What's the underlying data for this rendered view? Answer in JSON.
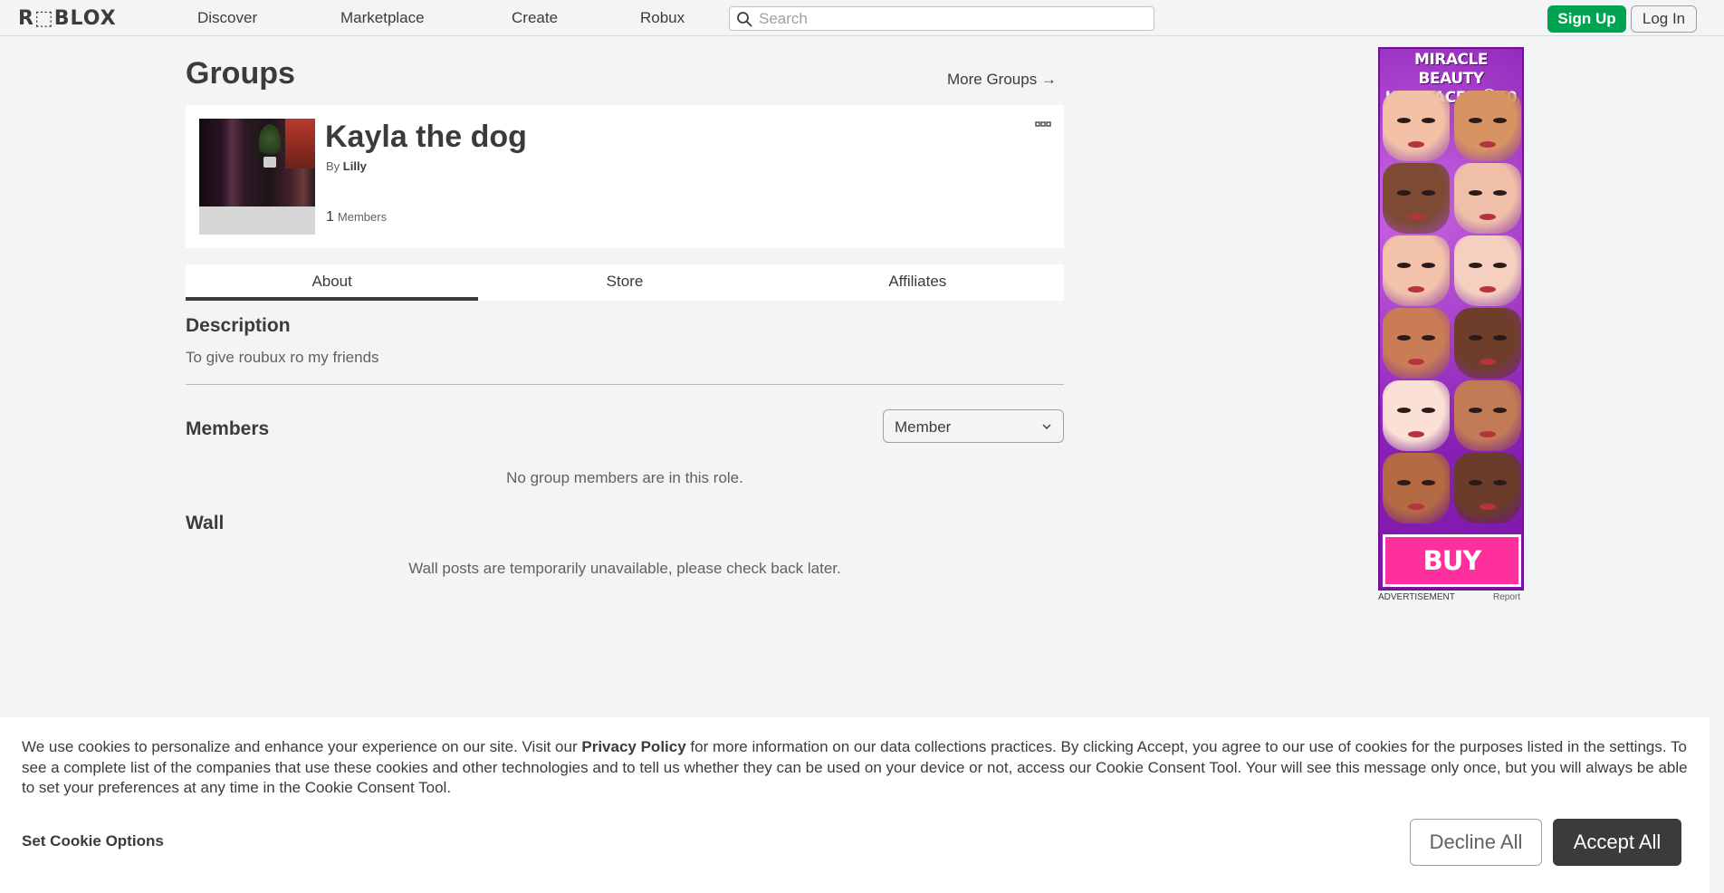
{
  "header": {
    "logo": "R⬚BLOX",
    "nav": [
      "Discover",
      "Marketplace",
      "Create",
      "Robux"
    ],
    "search_placeholder": "Search",
    "signup": "Sign Up",
    "login": "Log In"
  },
  "page": {
    "title": "Groups",
    "more_groups": "More Groups →"
  },
  "group": {
    "name": "Kayla the dog",
    "by_prefix": "By",
    "owner": "Lilly",
    "member_count": "1",
    "members_label": "Members"
  },
  "tabs": [
    "About",
    "Store",
    "Affiliates"
  ],
  "about": {
    "description_title": "Description",
    "description_text": "To give roubux ro my friends",
    "members_title": "Members",
    "role_selected": "Member",
    "members_empty": "No group members are in this role.",
    "wall_title": "Wall",
    "wall_message": "Wall posts are temporarily unavailable, please check back later."
  },
  "ad": {
    "line1": "MIRACLE BEAUTY",
    "line2": "UGC FACES Ⓡ50",
    "cta": "BUY NOW",
    "label": "ADVERTISEMENT",
    "report": "Report",
    "face_tones": [
      "#f2c1a6",
      "#d69463",
      "#7d4a33",
      "#f0bfa9",
      "#f3c2aa",
      "#f5cfc0",
      "#c97c56",
      "#6e3e2b",
      "#fbe1d5",
      "#c27c55",
      "#b46a42",
      "#6a3c29"
    ]
  },
  "cookie": {
    "text_before": "We use cookies to personalize and enhance your experience on our site. Visit our",
    "privacy_link": "Privacy Policy",
    "text_after": "for more information on our data collections practices. By clicking Accept, you agree to our use of cookies for the purposes listed in the settings. To see a complete list of the companies that use these cookies and other technologies and to tell us whether they can be used on your device or not, access our Cookie Consent Tool. Your will see this message only once, but you will always be able to set your preferences at any time in the Cookie Consent Tool.",
    "set_options": "Set Cookie Options",
    "decline": "Decline All",
    "accept": "Accept All"
  },
  "colors": {
    "primary_green": "#00a34f",
    "text_dark": "#393b3d",
    "background": "#f2f4f5"
  }
}
